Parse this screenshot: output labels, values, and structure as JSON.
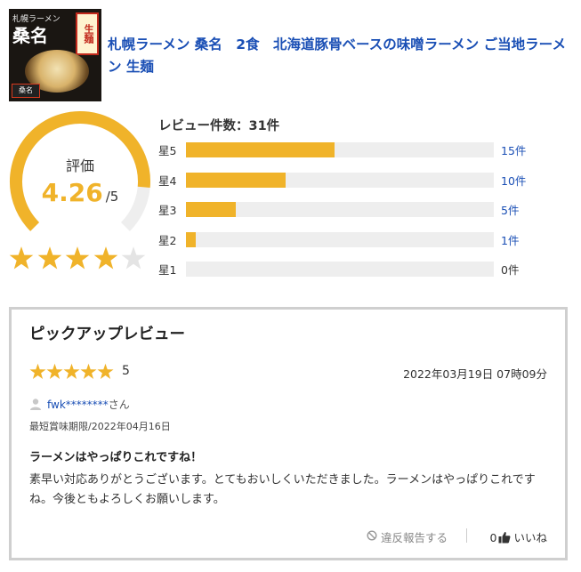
{
  "product": {
    "title": "札幌ラーメン 桑名　2食　北海道豚骨ベースの味噌ラーメン ご当地ラーメン 生麺",
    "thumbnail": {
      "shop_line1": "札幌ラーメン",
      "shop_line2": "桑名",
      "seal_text": "生麺",
      "tag_text": "桑名"
    }
  },
  "rating": {
    "label": "評価",
    "score": "4.26",
    "max": "/5",
    "score_value": 4.26,
    "max_value": 5,
    "stars_filled": 4,
    "stars_total": 5
  },
  "breakdown": {
    "title": "レビュー件数：31件",
    "total": 31,
    "rows": [
      {
        "label": "星5",
        "count": 15,
        "count_text": "15件"
      },
      {
        "label": "星4",
        "count": 10,
        "count_text": "10件"
      },
      {
        "label": "星3",
        "count": 5,
        "count_text": "5件"
      },
      {
        "label": "星2",
        "count": 1,
        "count_text": "1件"
      },
      {
        "label": "星1",
        "count": 0,
        "count_text": "0件"
      }
    ]
  },
  "pickup": {
    "heading": "ピックアップレビュー",
    "stars": 5,
    "score": "5",
    "date": "2022年03月19日 07時09分",
    "user": "fwk********",
    "user_suffix": "さん",
    "expiry": "最短賞味期限/2022年04月16日",
    "headline": "ラーメンはやっぱりこれですね！",
    "body": "素早い対応ありがとうございます。とてもおいしくいただきました。ラーメンはやっぱりこれですね。今後ともよろしくお願いします。",
    "report_label": "違反報告する",
    "like_count": "0",
    "like_label": "いいね"
  },
  "colors": {
    "accent": "#f0b32a",
    "link": "#1a4fb5",
    "track": "#eeeeee",
    "star_empty": "#e4e4e4"
  },
  "icons": {
    "user": "user-icon",
    "report": "prohibit-icon",
    "like": "thumbs-up-icon",
    "star": "star-icon"
  }
}
